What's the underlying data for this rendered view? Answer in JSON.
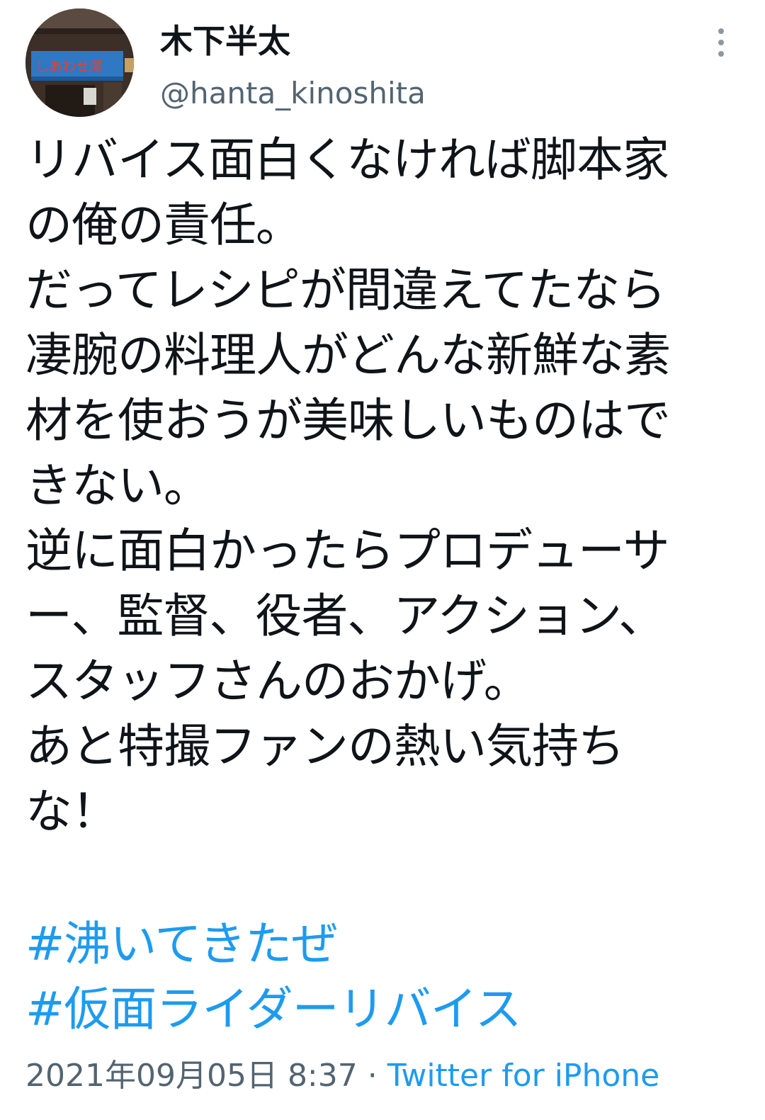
{
  "author": {
    "display_name": "木下半太",
    "handle": "@hanta_kinoshita",
    "avatar_sign_text": "しあわせ湯"
  },
  "tweet": {
    "lines": [
      "リバイス面白くなければ脚本家",
      "の俺の責任。",
      "だってレシピが間違えてたなら",
      "凄腕の料理人がどんな新鮮な素",
      "材を使おうが美味しいものはで",
      "きない。",
      "逆に面白かったらプロデューサ",
      "ー、監督、役者、アクション、",
      "スタッフさんのおかげ。",
      "あと特撮ファンの熱い気持ち",
      "な！"
    ],
    "hashtags": [
      "#沸いてきたぜ",
      "#仮面ライダーリバイス"
    ]
  },
  "meta": {
    "timestamp": "2021年09月05日 8:37",
    "separator": "·",
    "source": "Twitter for iPhone"
  },
  "icons": {
    "more": "more-options-icon"
  },
  "colors": {
    "text": "#0f1419",
    "secondary": "#536471",
    "link": "#1d9bf0",
    "background": "#ffffff"
  }
}
